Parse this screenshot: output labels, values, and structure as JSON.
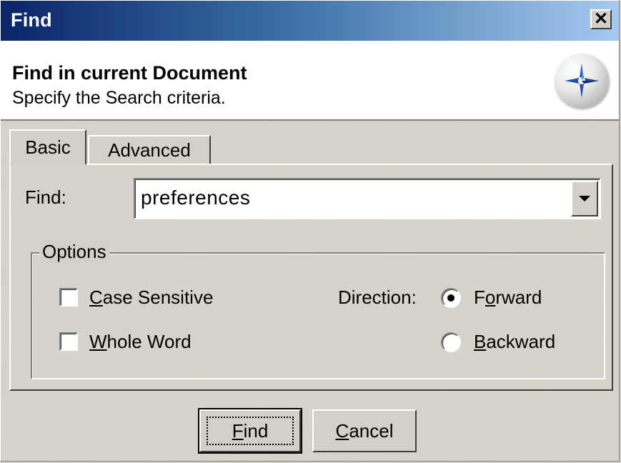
{
  "window": {
    "title": "Find",
    "close_glyph": "✕"
  },
  "header": {
    "title": "Find in current Document",
    "subtitle": "Specify the Search criteria.",
    "logo_icon": "compass-star-icon"
  },
  "tabs": [
    {
      "label": "Basic",
      "active": true
    },
    {
      "label": "Advanced",
      "active": false
    }
  ],
  "find": {
    "label": "Find:",
    "value": "preferences"
  },
  "options": {
    "legend": "Options",
    "case_sensitive": {
      "label_first": "C",
      "label_rest": "ase Sensitive",
      "checked": false
    },
    "whole_word": {
      "label_first": "W",
      "label_rest": "hole Word",
      "checked": false
    },
    "direction_label": "Direction:",
    "forward": {
      "label_first": "F",
      "label_u": "o",
      "label_rest": "rward",
      "selected": true
    },
    "backward": {
      "label_first": "B",
      "label_rest": "ackward",
      "selected": false
    }
  },
  "buttons": {
    "find": {
      "label_u": "F",
      "label_rest": "ind"
    },
    "cancel": {
      "label_u": "C",
      "label_rest": "ancel"
    }
  },
  "colors": {
    "titlebar_start": "#0a246a",
    "titlebar_end": "#a6caf0",
    "face": "#d4d0c8"
  }
}
